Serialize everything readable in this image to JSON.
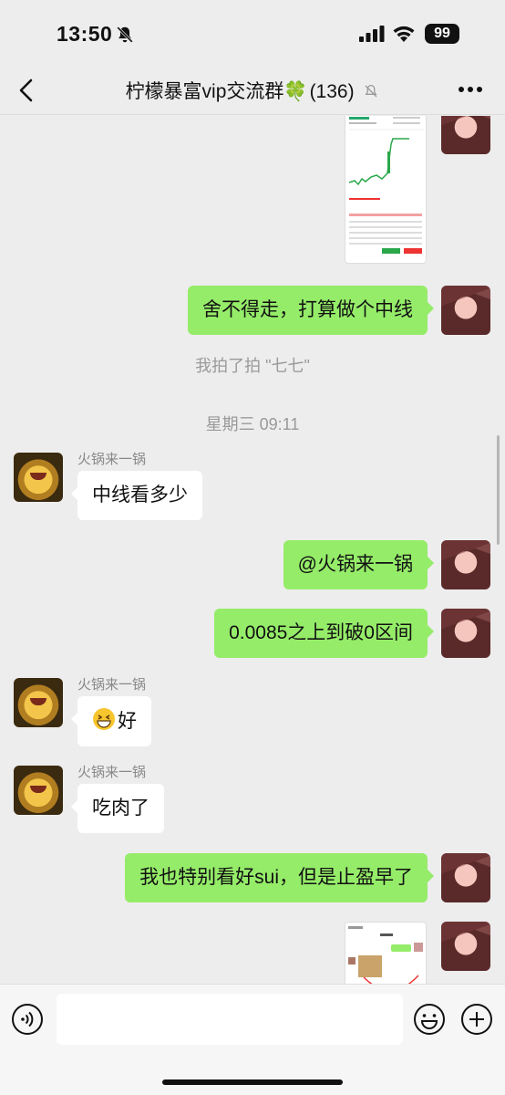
{
  "status_bar": {
    "time": "13:50",
    "battery": "99"
  },
  "header": {
    "title": "柠檬暴富vip交流群🍀",
    "member_count": "(136)"
  },
  "messages": {
    "m1_text": "舍不得走，打算做个中线",
    "pat_notice": "我拍了拍 \"七七\"",
    "timestamp": "星期三 09:11",
    "m2_sender": "火锅来一锅",
    "m2_text": "中线看多少",
    "m3_text": "@火锅来一锅",
    "m4_text": "0.0085之上到破0区间",
    "m5_sender": "火锅来一锅",
    "m5_text": "好",
    "m6_sender": "火锅来一锅",
    "m6_text": "吃肉了",
    "m7_text": "我也特别看好sui，但是止盈早了"
  },
  "input": {
    "placeholder": ""
  },
  "colors": {
    "bubble_me": "#95ec69",
    "bubble_other": "#ffffff",
    "background": "#ededed"
  },
  "icons": [
    "bell-off-icon",
    "signal-icon",
    "wifi-icon",
    "back-icon",
    "mute-icon",
    "more-icon",
    "voice-icon",
    "emoji-icon",
    "plus-icon"
  ]
}
